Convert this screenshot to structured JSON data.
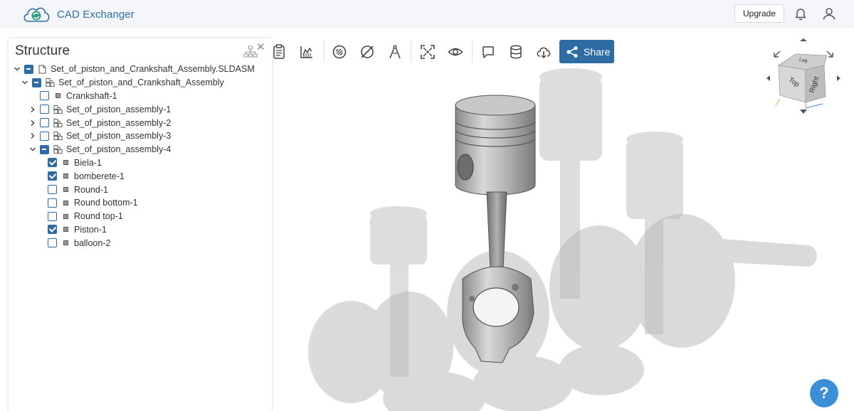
{
  "app": {
    "name": "CAD Exchanger"
  },
  "header": {
    "upgrade_label": "Upgrade"
  },
  "toolbar": {
    "share_label": "Share"
  },
  "structure": {
    "title": "Structure",
    "nodes": [
      {
        "label": "Set_of_piston_and_Crankshaft_Assembly.SLDASM",
        "level": 0,
        "expand": "down",
        "check": "partial",
        "icon": "file-icon"
      },
      {
        "label": "Set_of_piston_and_Crankshaft_Assembly",
        "level": 1,
        "expand": "down",
        "check": "partial",
        "icon": "assembly-icon"
      },
      {
        "label": "Crankshaft-1",
        "level": 2,
        "expand": "none",
        "check": "unchecked",
        "icon": "part-icon"
      },
      {
        "label": "Set_of_piston_assembly-1",
        "level": 2,
        "expand": "right",
        "check": "unchecked",
        "icon": "assembly-icon"
      },
      {
        "label": "Set_of_piston_assembly-2",
        "level": 2,
        "expand": "right",
        "check": "unchecked",
        "icon": "assembly-icon"
      },
      {
        "label": "Set_of_piston_assembly-3",
        "level": 2,
        "expand": "right",
        "check": "unchecked",
        "icon": "assembly-icon"
      },
      {
        "label": "Set_of_piston_assembly-4",
        "level": 2,
        "expand": "down",
        "check": "partial",
        "icon": "assembly-icon"
      },
      {
        "label": "Biela-1",
        "level": 3,
        "expand": "none",
        "check": "checked",
        "icon": "part-icon"
      },
      {
        "label": "bomberete-1",
        "level": 3,
        "expand": "none",
        "check": "checked",
        "icon": "part-icon"
      },
      {
        "label": "Round-1",
        "level": 3,
        "expand": "none",
        "check": "unchecked",
        "icon": "part-icon"
      },
      {
        "label": "Round bottom-1",
        "level": 3,
        "expand": "none",
        "check": "unchecked",
        "icon": "part-icon"
      },
      {
        "label": "Round top-1",
        "level": 3,
        "expand": "none",
        "check": "unchecked",
        "icon": "part-icon"
      },
      {
        "label": "Piston-1",
        "level": 3,
        "expand": "none",
        "check": "checked",
        "icon": "part-icon"
      },
      {
        "label": "balloon-2",
        "level": 3,
        "expand": "none",
        "check": "unchecked",
        "icon": "part-icon"
      }
    ]
  },
  "viewcube": {
    "front_face": "Top",
    "right_face": "Right",
    "top_face": "Left"
  },
  "help": {
    "label": "?"
  },
  "colors": {
    "accent": "#2e6da4",
    "help": "#3c8fd6",
    "ghost": "#c8c8c8"
  }
}
